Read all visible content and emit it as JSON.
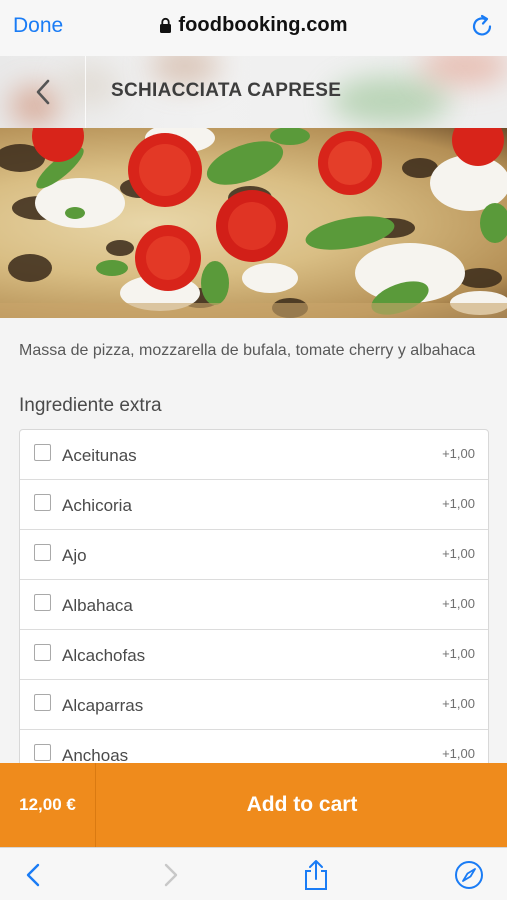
{
  "browser": {
    "done_label": "Done",
    "url": "foodbooking.com"
  },
  "header": {
    "title": "SCHIACCIATA CAPRESE"
  },
  "product": {
    "description": "Massa de pizza, mozzarella de bufala, tomate cherry y albahaca",
    "extras_label": "Ingrediente extra",
    "extras": [
      {
        "name": "Aceitunas",
        "price": "+1,00",
        "checked": false
      },
      {
        "name": "Achicoria",
        "price": "+1,00",
        "checked": false
      },
      {
        "name": "Ajo",
        "price": "+1,00",
        "checked": false
      },
      {
        "name": "Albahaca",
        "price": "+1,00",
        "checked": false
      },
      {
        "name": "Alcachofas",
        "price": "+1,00",
        "checked": false
      },
      {
        "name": "Alcaparras",
        "price": "+1,00",
        "checked": false
      },
      {
        "name": "Anchoas",
        "price": "+1,00",
        "checked": false
      }
    ]
  },
  "cart": {
    "total": "12,00 €",
    "add_label": "Add to cart"
  },
  "colors": {
    "accent": "#ef8b1c",
    "link": "#1a7cf5"
  },
  "icons": {
    "lock": "lock-icon",
    "reload": "reload-icon",
    "back": "chevron-left-icon",
    "nav_back": "chevron-left-icon",
    "nav_forward": "chevron-right-icon",
    "share": "share-icon",
    "compass": "compass-icon"
  }
}
